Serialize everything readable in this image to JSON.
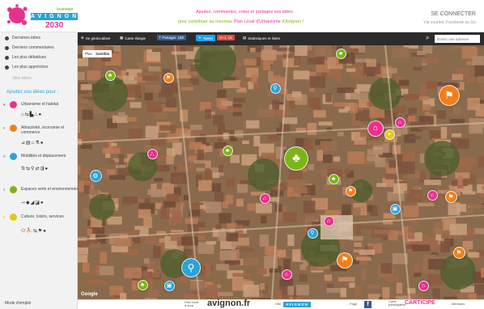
{
  "header": {
    "logo_tag": "Invention",
    "logo_city": "AVIGNON",
    "logo_year": "2030",
    "tagline_line1": "Ajoutez, commentez, votez et partagez vos idées",
    "tagline_line2_prefix": "pour contribuer au nouveau",
    "tagline_line2_highlight": "Plan Local d'Urbanisme",
    "tagline_line2_suffix": "d'Avignon !",
    "connect_title": "SE CONNECTER",
    "connect_sub": "Via courriel, Facebook ou Go"
  },
  "sidebar": {
    "menu": [
      {
        "label": "Dernières idées"
      },
      {
        "label": "Derniers commentaires"
      },
      {
        "label": "Les plus débattues"
      },
      {
        "label": "Les plus appréciées"
      }
    ],
    "mes_idees": "Mes idées",
    "ajoutez": "Ajoutez vos idées pour :",
    "categories": [
      {
        "label": "Urbanisme et habitat",
        "color": "#e7318e",
        "glyphs": "⌂⇆▙⛬●"
      },
      {
        "label": "Attractivité, économie et commerce",
        "color": "#f07f1b",
        "glyphs": "⊿▤⌂⚗●"
      },
      {
        "label": "Mobilités et déplacement",
        "color": "#2ba2d8",
        "glyphs": "⇅⇆⚲⇄⇶●"
      },
      {
        "label": "Espaces verts et environnement",
        "color": "#7cb518",
        "glyphs": "⇀◆◢◪●"
      },
      {
        "label": "Culture, loisirs, services",
        "color": "#e6c81b",
        "glyphs": "⚇⛹⇆⚑●"
      }
    ],
    "mode_emploi": "Mode d'emploi"
  },
  "toolbar": {
    "geoloc": "Se géolocaliser",
    "carte": "Carte élargie",
    "facebook": "Partager",
    "facebook_count": "185",
    "twitter": "Tweet",
    "gplus": "G+1",
    "gplus_count": "15",
    "stats": "Statistiques et listes",
    "search_placeholder": "Entrez une adresse"
  },
  "map": {
    "toggle_plan": "Plan",
    "toggle_satellite": "Satellite",
    "google": "Google"
  },
  "footer": {
    "plan_label": "Plan local d'urba",
    "city": "avignon.fr",
    "ville": "Ville",
    "logo_bar": "AVIGNON",
    "page": "Page",
    "carte": "Carte participative",
    "carticipe": "CARTICIPE",
    "mentions": "Mentions"
  },
  "colors": {
    "pink": "#e7318e",
    "orange": "#f07f1b",
    "blue": "#2ba2d8",
    "green": "#7cb518",
    "yellow": "#e6c81b"
  },
  "markers": [
    {
      "color": "#7cb518",
      "icon": "tree"
    },
    {
      "color": "#2ba2d8",
      "icon": "pedestrian"
    },
    {
      "color": "#7cb518",
      "icon": "tree"
    },
    {
      "color": "#f07f1b",
      "icon": "building"
    },
    {
      "color": "#f07f1b",
      "icon": "building"
    },
    {
      "color": "#e7318e",
      "icon": "house"
    },
    {
      "color": "#e7318e",
      "icon": "house"
    },
    {
      "color": "#e6c81b",
      "icon": "culture"
    },
    {
      "color": "#e7318e",
      "icon": "museum"
    },
    {
      "color": "#7cb518",
      "icon": "tree-large"
    },
    {
      "color": "#2ba2d8",
      "icon": "bike"
    },
    {
      "color": "#7cb518",
      "icon": "tree"
    },
    {
      "color": "#7cb518",
      "icon": "tree"
    },
    {
      "color": "#f07f1b",
      "icon": "building"
    },
    {
      "color": "#e7318e",
      "icon": "house"
    },
    {
      "color": "#2ba2d8",
      "icon": "bus"
    },
    {
      "color": "#e7318e",
      "icon": "house"
    },
    {
      "color": "#f07f1b",
      "icon": "building"
    },
    {
      "color": "#2ba2d8",
      "icon": "pedestrian"
    },
    {
      "color": "#f07f1b",
      "icon": "building"
    },
    {
      "color": "#e7318e",
      "icon": "house"
    },
    {
      "color": "#2ba2d8",
      "icon": "pedestrian-large"
    },
    {
      "color": "#7cb518",
      "icon": "tree"
    },
    {
      "color": "#2ba2d8",
      "icon": "bus"
    },
    {
      "color": "#e7318e",
      "icon": "house"
    },
    {
      "color": "#f07f1b",
      "icon": "building"
    },
    {
      "color": "#e7318e",
      "icon": "house"
    }
  ]
}
